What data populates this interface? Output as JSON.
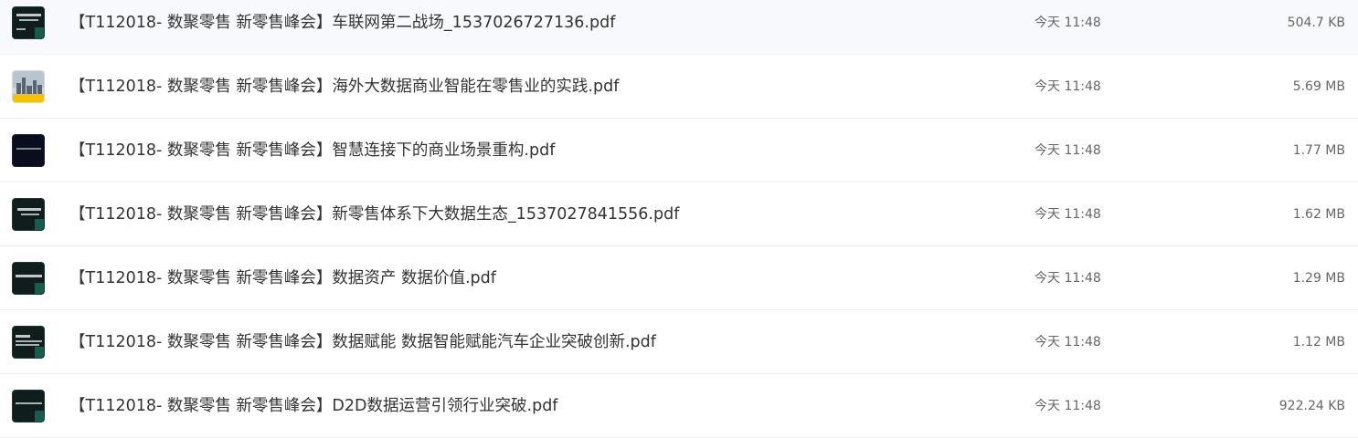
{
  "files": [
    {
      "name": "【T112018- 数聚零售 新零售峰会】车联网第二战场_1537026727136.pdf",
      "time": "今天 11:48",
      "size": "504.7 KB",
      "thumb_icon": "dark-slide-thumbnail"
    },
    {
      "name": "【T112018- 数聚零售 新零售峰会】海外大数据商业智能在零售业的实践.pdf",
      "time": "今天 11:48",
      "size": "5.69 MB",
      "thumb_icon": "city-photo-thumbnail"
    },
    {
      "name": "【T112018- 数聚零售 新零售峰会】智慧连接下的商业场景重构.pdf",
      "time": "今天 11:48",
      "size": "1.77 MB",
      "thumb_icon": "dark-slide-thumbnail"
    },
    {
      "name": "【T112018- 数聚零售 新零售峰会】新零售体系下大数据生态_1537027841556.pdf",
      "time": "今天 11:48",
      "size": "1.62 MB",
      "thumb_icon": "dark-slide-thumbnail"
    },
    {
      "name": "【T112018- 数聚零售 新零售峰会】数据资产 数据价值.pdf",
      "time": "今天 11:48",
      "size": "1.29 MB",
      "thumb_icon": "dark-slide-thumbnail"
    },
    {
      "name": "【T112018- 数聚零售 新零售峰会】数据赋能 数据智能赋能汽车企业突破创新.pdf",
      "time": "今天 11:48",
      "size": "1.12 MB",
      "thumb_icon": "dark-slide-thumbnail"
    },
    {
      "name": "【T112018- 数聚零售 新零售峰会】D2D数据运营引领行业突破.pdf",
      "time": "今天 11:48",
      "size": "922.24 KB",
      "thumb_icon": "dark-slide-thumbnail"
    }
  ],
  "colors": {
    "text_primary": "#333333",
    "text_secondary": "#666666",
    "divider": "#f0f0f0",
    "thumb_dark": "#0f1d1c",
    "thumb_accent": "#f5c200"
  }
}
